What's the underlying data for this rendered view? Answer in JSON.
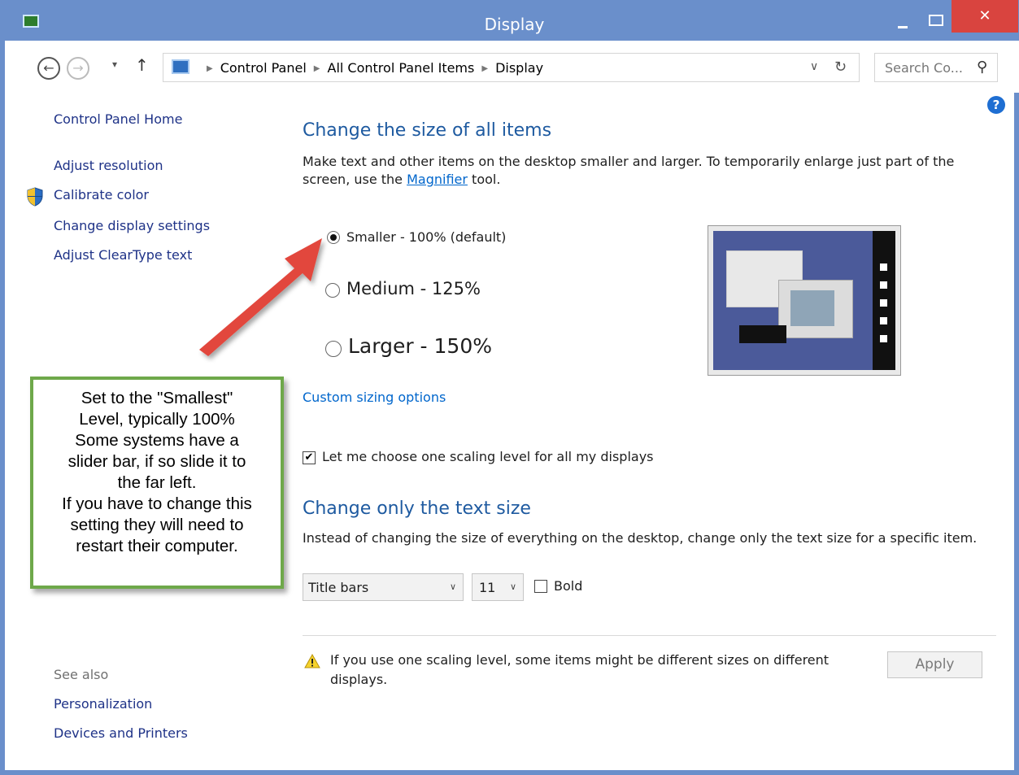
{
  "window": {
    "title": "Display",
    "close_glyph": "✕"
  },
  "nav": {
    "back_glyph": "←",
    "forward_glyph": "→",
    "recent_glyph": "▾",
    "up_glyph": "↑",
    "breadcrumb": [
      "Control Panel",
      "All Control Panel Items",
      "Display"
    ],
    "dropdown_glyph": "∨",
    "refresh_glyph": "↻",
    "search_placeholder": "Search Co...",
    "search_glyph": "⚲"
  },
  "help_glyph": "?",
  "sidebar": {
    "home": "Control Panel Home",
    "items": [
      "Adjust resolution",
      "Calibrate color",
      "Change display settings",
      "Adjust ClearType text"
    ],
    "see_also": "See also",
    "see_also_items": [
      "Personalization",
      "Devices and Printers"
    ]
  },
  "main": {
    "size_heading": "Change the size of all items",
    "size_desc_before": "Make text and other items on the desktop smaller and larger. To temporarily enlarge just part of the screen, use the ",
    "magnifier_link": "Magnifier",
    "size_desc_after": " tool.",
    "options": [
      {
        "label": "Smaller - 100% (default)",
        "selected": true
      },
      {
        "label": "Medium - 125%",
        "selected": false
      },
      {
        "label": "Larger - 150%",
        "selected": false
      }
    ],
    "custom_link": "Custom sizing options",
    "one_scaling_label": "Let me choose one scaling level for all my displays",
    "one_scaling_checked": true,
    "one_scaling_glyph": "✔",
    "text_heading": "Change only the text size",
    "text_desc": "Instead of changing the size of everything on the desktop, change only the text size for a specific item.",
    "item_select": "Title bars",
    "size_select": "11",
    "select_chevron": "∨",
    "bold_label": "Bold",
    "bold_checked": false,
    "warning": "If you use one scaling level, some items might be different sizes on different displays.",
    "apply_label": "Apply"
  },
  "annotation": {
    "text": "Set to the \"Smallest\"\nLevel, typically 100%\nSome systems have a\nslider bar, if so slide it to\nthe far left.\nIf you have to change this\nsetting they will need to\nrestart their computer.",
    "border_color": "#6ea84a",
    "arrow_color": "#e2463c"
  }
}
